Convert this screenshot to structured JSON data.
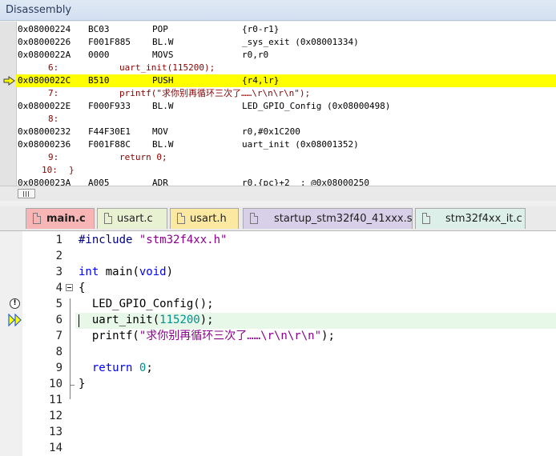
{
  "disassembly": {
    "title": "Disassembly",
    "lines": [
      {
        "kind": "asm",
        "addr": "0x08000224",
        "code": "BC03",
        "mnem": "POP",
        "ops": "{r0-r1}"
      },
      {
        "kind": "asm",
        "addr": "0x08000226",
        "code": "F001F885",
        "mnem": "BL.W",
        "ops": "_sys_exit (0x08001334)"
      },
      {
        "kind": "asm",
        "addr": "0x0800022A",
        "code": "0000",
        "mnem": "MOVS",
        "ops": "r0,r0"
      },
      {
        "kind": "src",
        "num": "6:",
        "text": "uart_init(115200);"
      },
      {
        "kind": "asm",
        "addr": "0x0800022C",
        "code": "B510",
        "mnem": "PUSH",
        "ops": "{r4,lr}",
        "current": true
      },
      {
        "kind": "src",
        "num": "7:",
        "text": "printf(\"求你别再循环三次了……\\r\\n\\r\\n\");"
      },
      {
        "kind": "asm",
        "addr": "0x0800022E",
        "code": "F000F933",
        "mnem": "BL.W",
        "ops": "LED_GPIO_Config (0x08000498)"
      },
      {
        "kind": "src",
        "num": "8:",
        "text": ""
      },
      {
        "kind": "asm",
        "addr": "0x08000232",
        "code": "F44F30E1",
        "mnem": "MOV",
        "ops": "r0,#0x1C200"
      },
      {
        "kind": "asm",
        "addr": "0x08000236",
        "code": "F001F88C",
        "mnem": "BL.W",
        "ops": "uart_init (0x08001352)"
      },
      {
        "kind": "src",
        "num": "9:",
        "text": "return 0;"
      },
      {
        "kind": "src",
        "num": "10:",
        "text": "}"
      },
      {
        "kind": "asm",
        "addr": "0x0800023A",
        "code": "A005",
        "mnem": "ADR",
        "ops": "r0,{pc}+2  ; @0x08000250"
      }
    ]
  },
  "tabs": [
    {
      "label": "main.c",
      "active": true,
      "color": "#f7b5b5",
      "icon": "c-file-icon"
    },
    {
      "label": "usart.c",
      "active": false,
      "color": "#e8f2d2",
      "icon": "c-file-icon"
    },
    {
      "label": "usart.h",
      "active": false,
      "color": "#fbe9a2",
      "icon": "h-file-icon"
    },
    {
      "label": "startup_stm32f40_41xxx.s",
      "active": false,
      "color": "#d8cfe8",
      "icon": "asm-file-icon"
    },
    {
      "label": "stm32f4xx_it.c",
      "active": false,
      "color": "#dcefe8",
      "icon": "c-file-icon"
    }
  ],
  "editor": {
    "line_numbers": [
      "1",
      "2",
      "3",
      "4",
      "5",
      "6",
      "7",
      "8",
      "9",
      "10",
      "11",
      "12",
      "13",
      "14"
    ],
    "code": {
      "l1_pre": "#include",
      "l1_str": "\"stm32f4xx.h\"",
      "l3_kw1": "int",
      "l3_mid": " main(",
      "l3_kw2": "void",
      "l3_end": ")",
      "l4": "{",
      "l5": "  LED_GPIO_Config();",
      "l6_a": "  uart_init(",
      "l6_num": "115200",
      "l6_b": ");",
      "l7_a": "  printf(",
      "l7_str": "\"求你别再循环三次了……\\r\\n\\r\\n\"",
      "l7_b": ");",
      "l9_kw": "  return",
      "l9_sp": " ",
      "l9_num": "0",
      "l9_b": ";",
      "l10": "}"
    },
    "current_line": "6",
    "warning_line": "5"
  }
}
